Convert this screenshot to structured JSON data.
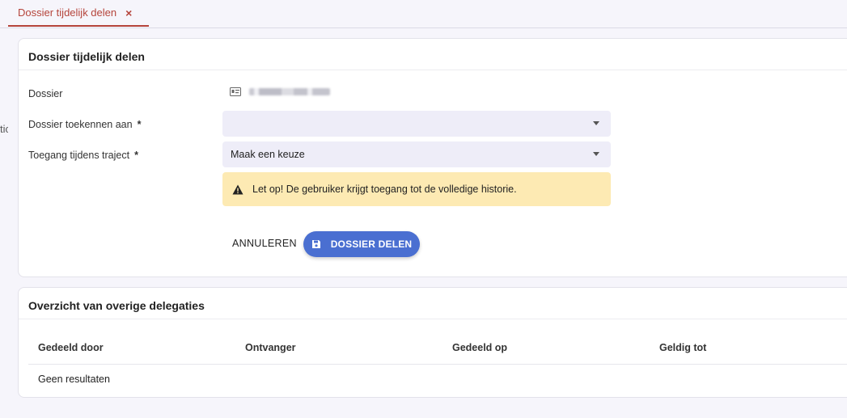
{
  "tab": {
    "label": "Dossier tijdelijk delen",
    "close_symbol": "×"
  },
  "side_fragment": "tic",
  "form": {
    "title": "Dossier tijdelijk delen",
    "dossier_label": "Dossier",
    "assign_label": "Dossier toekennen aan",
    "assign_value": "",
    "access_label": "Toegang tijdens traject",
    "access_value": "Maak een keuze",
    "required_mark": "*",
    "warning": "Let op! De gebruiker krijgt toegang tot de volledige historie.",
    "cancel_label": "ANNULEREN",
    "submit_label": "DOSSIER DELEN"
  },
  "overview": {
    "title": "Overzicht van overige delegaties",
    "columns": [
      "Gedeeld door",
      "Ontvanger",
      "Gedeeld op",
      "Geldig tot"
    ],
    "empty_text": "Geen resultaten"
  },
  "colors": {
    "accent": "#b5443b",
    "primary": "#4a6fd1",
    "warning_bg": "#fdeab3",
    "select_bg": "#eeedf8"
  },
  "icons": [
    "id-card-icon",
    "warning-icon",
    "save-icon",
    "close-icon",
    "chevron-down-icon"
  ]
}
